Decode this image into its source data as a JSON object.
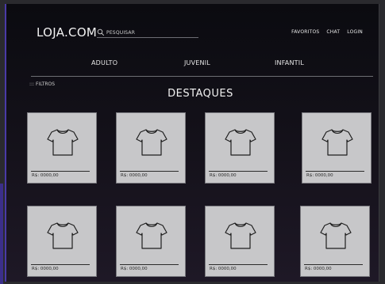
{
  "header": {
    "logo": "LOJA.COM",
    "search_placeholder": "PESQUISAR",
    "nav": [
      "FAVORITOS",
      "CHAT",
      "LOGIN"
    ]
  },
  "categories": [
    "ADULTO",
    "JUVENIL",
    "INFANTIL"
  ],
  "filters": {
    "label": "::: FILTROS"
  },
  "section": {
    "title": "DESTAQUES"
  },
  "products": [
    {
      "price": "R$: 0000,00",
      "icon": "tshirt-icon"
    },
    {
      "price": "R$: 0000,00",
      "icon": "tshirt-icon"
    },
    {
      "price": "R$: 0000,00",
      "icon": "tshirt-icon"
    },
    {
      "price": "R$: 0000,00",
      "icon": "tshirt-icon"
    },
    {
      "price": "R$: 0000,00",
      "icon": "tshirt-icon"
    },
    {
      "price": "R$: 0000,00",
      "icon": "tshirt-icon"
    },
    {
      "price": "R$: 0000,00",
      "icon": "tshirt-icon"
    },
    {
      "price": "R$: 0000,00",
      "icon": "tshirt-icon"
    }
  ],
  "colors": {
    "background": "#0b0b10",
    "card": "#c7c7c9",
    "text": "#f2f2f2",
    "accent": "#4a3aa8"
  }
}
